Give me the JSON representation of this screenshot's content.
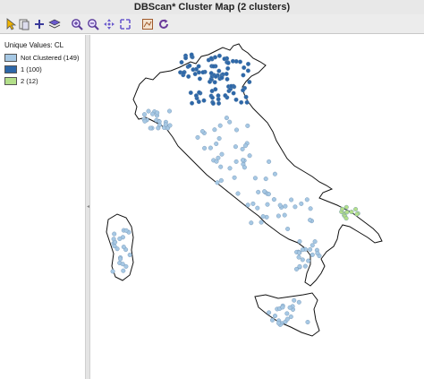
{
  "window": {
    "title": "DBScan* Cluster Map (2 clusters)"
  },
  "toolbar": {
    "tools": [
      {
        "name": "select-arrow-icon"
      },
      {
        "name": "copy-icon"
      },
      {
        "name": "add-icon"
      },
      {
        "name": "layers-icon"
      },
      {
        "name": "zoom-in-icon"
      },
      {
        "name": "zoom-out-icon"
      },
      {
        "name": "pan-icon"
      },
      {
        "name": "full-extent-icon"
      },
      {
        "name": "map-basemap-icon"
      },
      {
        "name": "refresh-icon"
      }
    ]
  },
  "legend": {
    "title": "Unique Values: CL",
    "items": [
      {
        "label": "Not Clustered (149)",
        "color": "#a6c8e4"
      },
      {
        "label": "1 (100)",
        "color": "#2d67a8"
      },
      {
        "label": "2 (12)",
        "color": "#b3df8a"
      }
    ]
  }
}
